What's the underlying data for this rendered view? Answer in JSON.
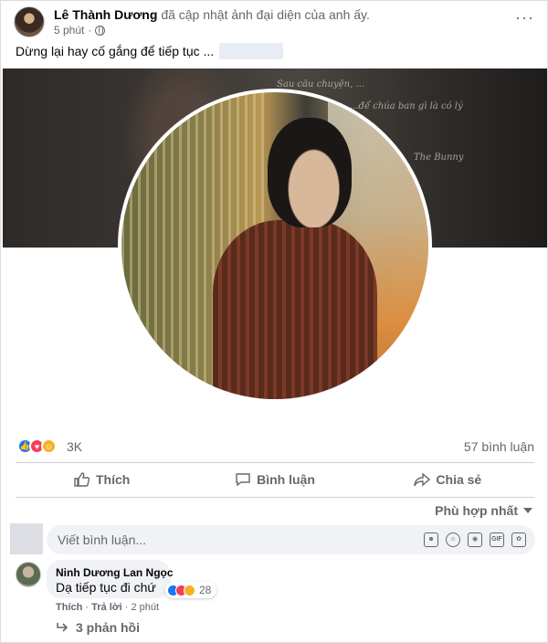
{
  "post": {
    "author": "Lê Thành Dương",
    "action": "đã cập nhật ảnh đại diện của anh ấy.",
    "time": "5 phút",
    "more": "···",
    "caption": "Dừng lại hay cố gắng để tiếp tục ..."
  },
  "cover_notes": [
    "Sau câu chuyện, ...",
    "...để chúa ban gì là có lý",
    "The Bunny"
  ],
  "stats": {
    "reaction_count": "3K",
    "comments": "57 bình luận"
  },
  "actions": {
    "like": "Thích",
    "comment": "Bình luận",
    "share": "Chia sẻ"
  },
  "sort": "Phù hợp nhất",
  "comment_input": {
    "placeholder": "Viết bình luận..."
  },
  "comment": {
    "name": "Ninh Dương Lan Ngọc",
    "text": "Dạ tiếp tục đi chứ",
    "reaction_count": "28",
    "like": "Thích",
    "reply": "Trả lời",
    "time": "2 phút",
    "replies": "3 phản hồi"
  },
  "colors": {
    "like": "#1877f2",
    "love": "#f33e58",
    "haha": "#f7b125",
    "muted_text": "#65676b"
  }
}
